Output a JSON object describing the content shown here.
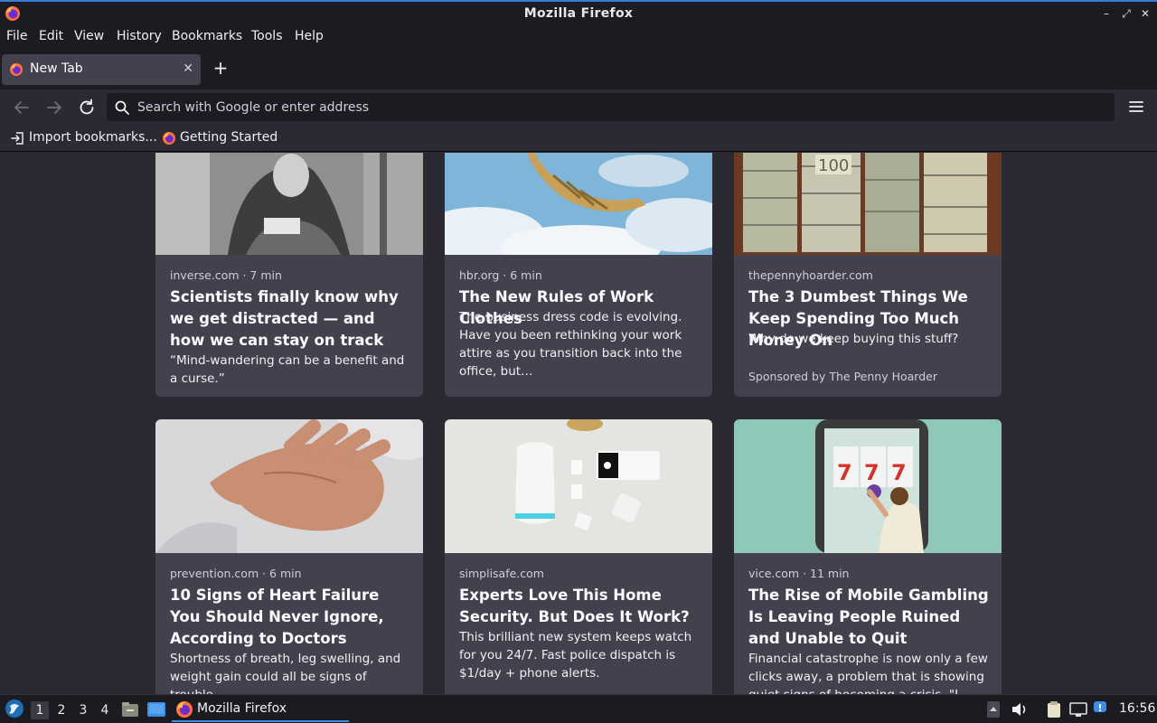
{
  "window": {
    "title": "Mozilla Firefox",
    "controls": [
      "minimize",
      "maximize",
      "close"
    ]
  },
  "menubar": {
    "items": [
      "File",
      "Edit",
      "View",
      "History",
      "Bookmarks",
      "Tools",
      "Help"
    ]
  },
  "tabs": [
    {
      "label": "New Tab",
      "active": true
    }
  ],
  "newtab_label": "+",
  "urlbar": {
    "placeholder": "Search with Google or enter address",
    "value": ""
  },
  "bookmarks": [
    {
      "label": "Import bookmarks...",
      "icon": "import-icon"
    },
    {
      "label": "Getting Started",
      "icon": "firefox-icon"
    }
  ],
  "stories": [
    {
      "source": "inverse.com · 7 min",
      "title": "Scientists finally know why we get distracted — and how we can stay on track",
      "excerpt": "“Mind-wandering can be a benefit and a curse.”",
      "image": "engraving-woman-reading"
    },
    {
      "source": "hbr.org · 6 min",
      "title": "The New Rules of Work Clothes",
      "excerpt": "The business dress code is evolving. Have you been rethinking your work attire as you transition back into the office, but…",
      "image": "tie-in-sky"
    },
    {
      "source": "thepennyhoarder.com",
      "title": "The 3 Dumbest Things We Keep Spending Too Much Money On",
      "excerpt": "Why do we keep buying this stuff?",
      "sponsor": "Sponsored by The Penny Hoarder",
      "image": "stacks-of-dollar-bills"
    },
    {
      "source": "prevention.com · 6 min",
      "title": "10 Signs of Heart Failure You Should Never Ignore, According to Doctors",
      "excerpt": "Shortness of breath, leg swelling, and weight gain could all be signs of trouble.",
      "image": "hand-on-chest"
    },
    {
      "source": "simplisafe.com",
      "title": "Experts Love This Home Security. But Does It Work?",
      "excerpt": "This brilliant new system keeps watch for you 24/7. Fast police dispatch is $1/day + phone alerts.",
      "image": "home-security-devices"
    },
    {
      "source": "vice.com · 11 min",
      "title": "The Rise of Mobile Gambling Is Leaving People Ruined and Unable to Quit",
      "excerpt": "Financial catastrophe is now only a few clicks away, a problem that is showing quiet signs of becoming a crisis. \"I can't",
      "image": "phone-slot-machine"
    }
  ],
  "taskbar": {
    "workspaces": [
      "1",
      "2",
      "3",
      "4"
    ],
    "active_workspace": "1",
    "task_label": "Mozilla Firefox",
    "clock": "16:56"
  },
  "colors": {
    "chrome": "#1c1b22",
    "toolbar": "#2b2a33",
    "card": "#42414d",
    "accent": "#3d8ee6"
  }
}
